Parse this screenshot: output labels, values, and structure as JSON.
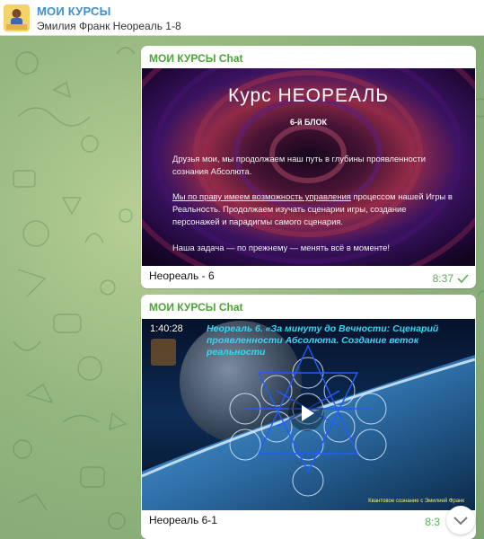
{
  "header": {
    "title": "МОИ КУРСЫ",
    "subtitle": "Эмилия Франк  Неореаль 1-8",
    "avatar_icon": "channel-avatar-icon"
  },
  "messages": [
    {
      "sender": "МОИ КУРСЫ Chat",
      "caption": "Неореаль - 6",
      "time": "8:37",
      "read_icon": "checkmark-icon",
      "slide": {
        "title": "Курс  НЕОРЕАЛЬ",
        "block": "6-й БЛОК",
        "p1": "Друзья мои, мы продолжаем наш путь в глубины проявленности сознания Абсолюта.",
        "p2_underlined": "Мы по праву имеем возможность управления",
        "p2_rest": " процессом нашей Игры в Реальность. Продолжаем изучать сценарии игры, создание персонажей и парадигмы самого сценария.",
        "p3": "Наша задача — по прежнему — менять всё в моменте!"
      }
    },
    {
      "sender": "МОИ КУРСЫ Chat",
      "caption": "Неореаль 6-1",
      "time": "8:3",
      "video": {
        "duration": "1:40:28",
        "title": "Неореаль 6. «За минуту до Вечности: Сценарий проявленности Абсолюта. Создание веток реальности",
        "footer": "Квантовое сознание с Эмилией Франк",
        "play_icon": "play-icon"
      }
    }
  ],
  "scroll_button_icon": "chevron-down-icon",
  "colors": {
    "accent": "#3d8ed0",
    "sender": "#4ea33a",
    "time": "#5faa57",
    "video_title": "#35d7f2"
  }
}
